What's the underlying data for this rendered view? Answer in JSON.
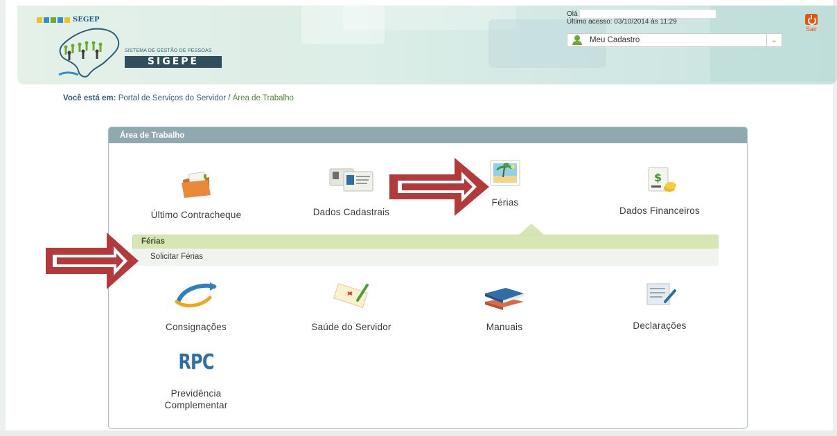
{
  "header": {
    "org": "SEGEP",
    "system_label": "SISTEMA DE GESTÃO DE PESSOAS",
    "system_name": "SIGEPE",
    "greeting": "Olá",
    "last_access": "Último acesso: 03/10/2014 às 11:29",
    "profile_select": "Meu Cadastro",
    "logout_label": "Sair"
  },
  "breadcrumb": {
    "lead": "Você está em:",
    "items": [
      "Portal de Serviços do Servidor",
      "Área de Trabalho"
    ],
    "separator": "/"
  },
  "panel": {
    "title": "Área de Trabalho",
    "tiles_row1": [
      "Último Contracheque",
      "Dados Cadastrais",
      "Férias",
      "Dados Financeiros"
    ],
    "submenu": {
      "title": "Férias",
      "items": [
        "Solicitar Férias"
      ]
    },
    "tiles_row2": [
      "Consignações",
      "Saúde do Servidor",
      "Manuais",
      "Declarações"
    ],
    "tiles_row3": {
      "logo_text": "RPC",
      "label_line1": "Previdência",
      "label_line2": "Complementar"
    }
  },
  "annotations": {
    "arrow_color": "#b23a3a"
  },
  "colors": {
    "panel_header": "#8fa9ae",
    "submenu_header": "#d7e6b2",
    "logout": "#e8540c",
    "breadcrumb_current": "#4b8a2e"
  }
}
